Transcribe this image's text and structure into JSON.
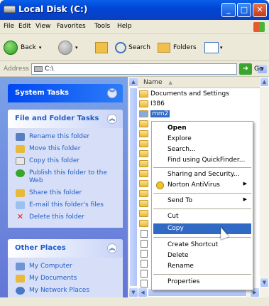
{
  "window": {
    "title": "Local Disk (C:)"
  },
  "menubar": [
    "File",
    "Edit",
    "View",
    "Favorites",
    "Tools",
    "Help"
  ],
  "toolbar": {
    "back": "Back",
    "search": "Search",
    "folders": "Folders"
  },
  "address": {
    "label": "Address",
    "value": "C:\\",
    "go": "Go"
  },
  "system_tasks": {
    "title": "System Tasks"
  },
  "file_folder_tasks": {
    "title": "File and Folder Tasks",
    "items": [
      "Rename this folder",
      "Move this folder",
      "Copy this folder",
      "Publish this folder to the Web",
      "Share this folder",
      "E-mail this folder's files",
      "Delete this folder"
    ]
  },
  "other_places": {
    "title": "Other Places",
    "items": [
      "My Computer",
      "My Documents",
      "My Network Places"
    ]
  },
  "list": {
    "column": "Name",
    "items": [
      "Documents and Settings",
      "I386",
      "mm2"
    ]
  },
  "context_menu": {
    "items": [
      "Open",
      "Explore",
      "Search...",
      "Find using QuickFinder...",
      "Sharing and Security...",
      "Norton AntiVirus",
      "Send To",
      "Cut",
      "Copy",
      "Create Shortcut",
      "Delete",
      "Rename",
      "Properties"
    ]
  },
  "colors": {
    "selection": "#316ac5",
    "title": "#0046d5",
    "panel_link": "#215dc6"
  }
}
